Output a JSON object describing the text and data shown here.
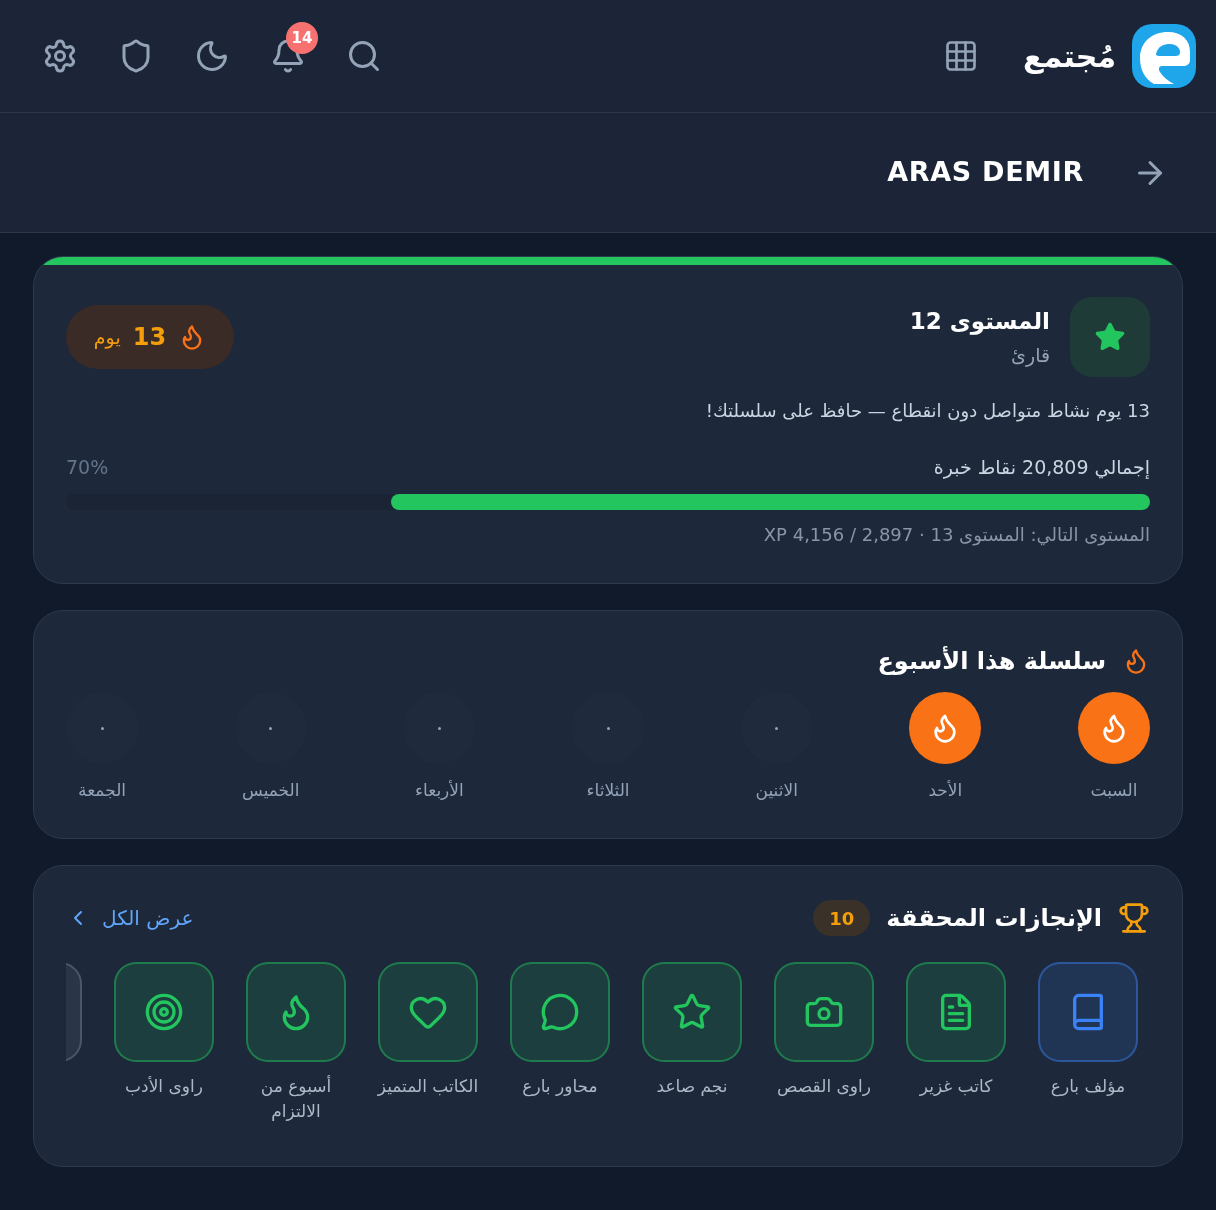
{
  "header": {
    "brand": "مُجتمع",
    "notification_count": "14"
  },
  "profile_bar": {
    "name": "ARAS DEMIR"
  },
  "level_card": {
    "title": "المستوى 12",
    "rank": "قارئ",
    "streak": {
      "count": "13",
      "unit": "يوم"
    },
    "message": "13 يوم نشاط متواصل دون انقطاع — حافظ على سلسلتك!",
    "total_xp": "إجمالي 20,809 نقاط خبرة",
    "percent": "70%",
    "level": 0.7,
    "next_level": "المستوى التالي: المستوى 13 · 2,897 / 4,156 XP"
  },
  "week_streak": {
    "title": "سلسلة هذا الأسبوع",
    "days": [
      {
        "label": "السبت",
        "active": true
      },
      {
        "label": "الأحد",
        "active": true
      },
      {
        "label": "الاثنين",
        "active": false
      },
      {
        "label": "الثلاثاء",
        "active": false
      },
      {
        "label": "الأربعاء",
        "active": false
      },
      {
        "label": "الخميس",
        "active": false
      },
      {
        "label": "الجمعة",
        "active": false
      }
    ]
  },
  "achievements": {
    "title": "الإنجازات المحققة",
    "count": "10",
    "view_all": "عرض الكل",
    "items": [
      {
        "label": "مؤلف بارع",
        "color": "#3b82f6"
      },
      {
        "label": "كاتب غزير",
        "color": "#22c55e"
      },
      {
        "label": "راوى القصص",
        "color": "#22c55e"
      },
      {
        "label": "نجم صاعد",
        "color": "#22c55e"
      },
      {
        "label": "محاور بارع",
        "color": "#22c55e"
      },
      {
        "label": "الكاتب المتميز",
        "color": "#22c55e"
      },
      {
        "label": "أسبوع من الالتزام",
        "color": "#22c55e"
      },
      {
        "label": "راوى الأدب",
        "color": "#22c55e"
      }
    ],
    "more_hidden": true
  }
}
